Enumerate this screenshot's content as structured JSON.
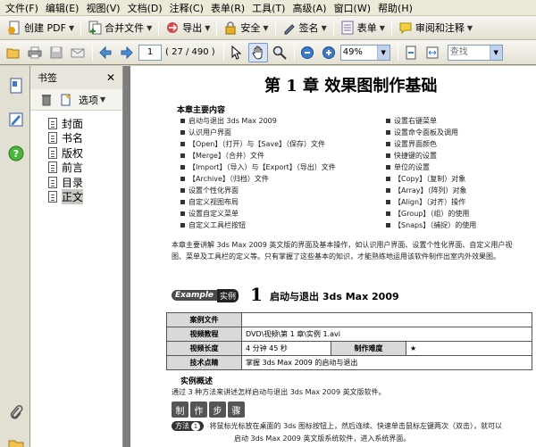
{
  "menu": [
    "文件(F)",
    "编辑(E)",
    "视图(V)",
    "文档(D)",
    "注释(C)",
    "表单(R)",
    "工具(T)",
    "高级(A)",
    "窗口(W)",
    "帮助(H)"
  ],
  "toolbar1": {
    "create_pdf": "创建 PDF",
    "combine": "合并文件",
    "export": "导出",
    "security": "安全",
    "sign": "签名",
    "forms": "表单",
    "review": "审阅和注释"
  },
  "toolbar2": {
    "page_number": "1",
    "page_count": "( 27 / 490 )",
    "zoom": "49%",
    "search_placeholder": "查找"
  },
  "bookmarks": {
    "title": "书签",
    "options_label": "选项",
    "items": [
      {
        "label": "封面",
        "selected": false
      },
      {
        "label": "书名",
        "selected": false
      },
      {
        "label": "版权",
        "selected": false
      },
      {
        "label": "前言",
        "selected": false
      },
      {
        "label": "目录",
        "selected": false
      },
      {
        "label": "正文",
        "selected": true
      }
    ]
  },
  "document": {
    "chapter_title": "第 1 章    效果图制作基础",
    "key_points_heading": "本章主要内容",
    "key_points_left": [
      "启动与退出 3ds Max 2009",
      "认识用户界面",
      "【Open】（打开）与【Save】（保存）文件",
      "【Merge】（合并）文件",
      "【Import】（导入）与【Export】（导出）文件",
      "【Archive】（归档）文件",
      "设置个性化界面",
      "自定义视图布局",
      "设置自定义菜单",
      "自定义工具栏按钮"
    ],
    "key_points_right": [
      "设置右键菜单",
      "设置命令面板及调用",
      "设置界面颜色",
      "快捷键的设置",
      "单位的设置",
      "【Copy】（复制）对象",
      "【Array】（阵列）对象",
      "【Align】（对齐）操作",
      "【Group】（组）的使用",
      "【Snaps】（捕捉）的使用"
    ],
    "intro": "本章主要讲解 3ds Max 2009 英文版的界面及基本操作，如认识用户界面、设置个性化界面、自定义用户视图、菜单及工具栏的定义等。只有掌握了这些基本的知识，才能熟练地运用该软件制作出室内外效果图。",
    "example_en": "Example",
    "example_cn": "实例",
    "example_number": "1",
    "example_title": "启动与退出 3ds Max 2009",
    "table": {
      "row1_label": "案例文件",
      "row1_value": "",
      "row2_label": "视频教程",
      "row2_value": "DVD\\视频\\第 1 章\\实例 1.avi",
      "row3_label": "视频长度",
      "row3_value": "4 分钟 45 秒",
      "row3_label2": "制作难度",
      "row3_value2": "★",
      "row4_label": "技术点睛",
      "row4_value": "掌握 3ds Max 2009 的启动与退出"
    },
    "overview_heading": "实例概述",
    "overview_text": "通过 3 种方法来讲述怎样启动与退出 3ds Max 2009 英文版软件。",
    "steps": [
      "制",
      "作",
      "步",
      "骤"
    ],
    "method_label": "方法",
    "method_number": "1",
    "method_line1": "将鼠标光标放在桌面的 3ds 图标按钮上，然后连续、快速单击鼠标左键两次（双击），就可以",
    "method_line2": "启动 3ds Max 2009 英文版系统软件，进入系统界面。"
  }
}
